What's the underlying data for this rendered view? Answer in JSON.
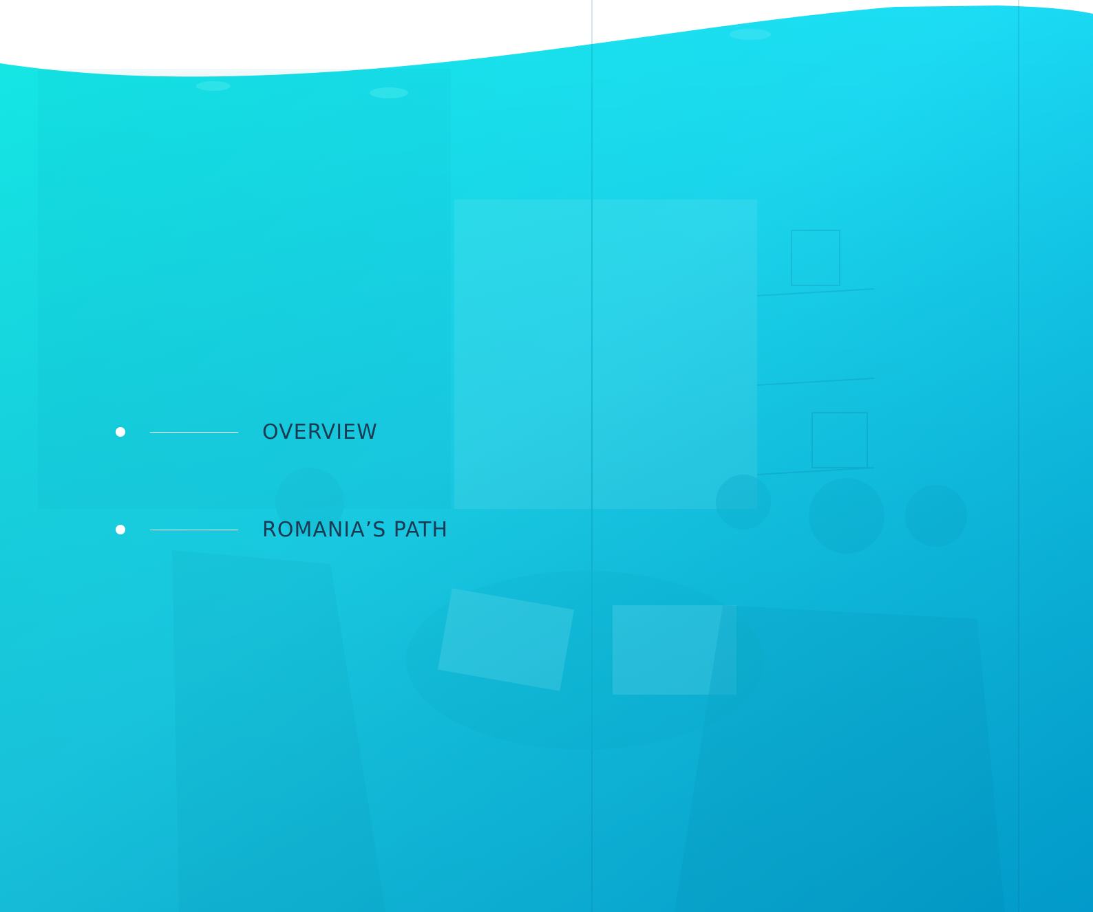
{
  "colors": {
    "gradient_top": "#13e9ea",
    "gradient_mid": "#1fd9f4",
    "gradient_bottom": "#03b3e3",
    "nav_text": "#1b3b55",
    "bullet": "#ffffff"
  },
  "background": {
    "description_icon": "meeting-room-photo-overlay"
  },
  "nav": {
    "items": [
      {
        "label": "OVERVIEW"
      },
      {
        "label": "ROMANIA’S PATH"
      }
    ]
  }
}
